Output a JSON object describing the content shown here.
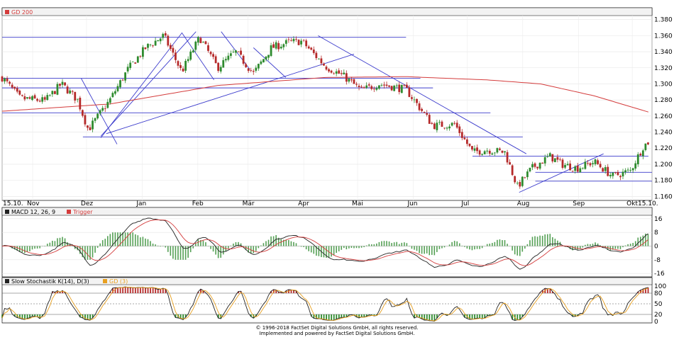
{
  "footer": {
    "line1": "© 1996-2018 FactSet Digital Solutions GmbH, all rights reserved.",
    "line2": "Implemented and powered by FactSet Digital Solutions GmbH."
  },
  "chart_data": [
    {
      "type": "candlestick",
      "legend": [
        "GD 200"
      ],
      "colors": {
        "up": "#2e8b2e",
        "down": "#b52a2a",
        "gd200": "#d43c3c",
        "trendline": "#3c3ccc"
      },
      "x_ticks": [
        "15.10.",
        "Nov",
        "Dez",
        "Jan",
        "Feb",
        "Mär",
        "Apr",
        "Mai",
        "Jun",
        "Jul",
        "Aug",
        "Sep",
        "Okt",
        "15.10."
      ],
      "y_ticks": [
        1.16,
        1.18,
        1.2,
        1.22,
        1.24,
        1.26,
        1.28,
        1.3,
        1.32,
        1.34,
        1.36,
        1.38
      ],
      "ylim": [
        1.155,
        1.385
      ],
      "close_path": [
        {
          "d": 0,
          "v": 1.308
        },
        {
          "d": 10,
          "v": 1.282
        },
        {
          "d": 24,
          "v": 1.279
        },
        {
          "d": 33,
          "v": 1.3
        },
        {
          "d": 42,
          "v": 1.28
        },
        {
          "d": 48,
          "v": 1.243
        },
        {
          "d": 60,
          "v": 1.28
        },
        {
          "d": 70,
          "v": 1.318
        },
        {
          "d": 80,
          "v": 1.345
        },
        {
          "d": 90,
          "v": 1.36
        },
        {
          "d": 100,
          "v": 1.315
        },
        {
          "d": 110,
          "v": 1.358
        },
        {
          "d": 120,
          "v": 1.32
        },
        {
          "d": 130,
          "v": 1.34
        },
        {
          "d": 140,
          "v": 1.313
        },
        {
          "d": 150,
          "v": 1.345
        },
        {
          "d": 160,
          "v": 1.352
        },
        {
          "d": 167,
          "v": 1.353
        },
        {
          "d": 180,
          "v": 1.322
        },
        {
          "d": 190,
          "v": 1.31
        },
        {
          "d": 200,
          "v": 1.292
        },
        {
          "d": 210,
          "v": 1.3
        },
        {
          "d": 225,
          "v": 1.293
        },
        {
          "d": 240,
          "v": 1.248
        },
        {
          "d": 252,
          "v": 1.25
        },
        {
          "d": 262,
          "v": 1.215
        },
        {
          "d": 270,
          "v": 1.218
        },
        {
          "d": 280,
          "v": 1.215
        },
        {
          "d": 287,
          "v": 1.172
        },
        {
          "d": 295,
          "v": 1.195
        },
        {
          "d": 305,
          "v": 1.21
        },
        {
          "d": 312,
          "v": 1.2
        },
        {
          "d": 320,
          "v": 1.195
        },
        {
          "d": 330,
          "v": 1.203
        },
        {
          "d": 340,
          "v": 1.185
        },
        {
          "d": 350,
          "v": 1.192
        },
        {
          "d": 357,
          "v": 1.222
        },
        {
          "d": 360,
          "v": 1.228
        }
      ],
      "gd200": [
        {
          "d": 0,
          "v": 1.266
        },
        {
          "d": 60,
          "v": 1.275
        },
        {
          "d": 120,
          "v": 1.298
        },
        {
          "d": 180,
          "v": 1.308
        },
        {
          "d": 225,
          "v": 1.309
        },
        {
          "d": 270,
          "v": 1.305
        },
        {
          "d": 300,
          "v": 1.3
        },
        {
          "d": 330,
          "v": 1.285
        },
        {
          "d": 360,
          "v": 1.265
        }
      ],
      "horizontal_lines": [
        {
          "v": 1.358,
          "d0": 0,
          "d1": 225
        },
        {
          "v": 1.307,
          "d0": 0,
          "d1": 233
        },
        {
          "v": 1.295,
          "d0": 0,
          "d1": 240
        },
        {
          "v": 1.264,
          "d0": 0,
          "d1": 272
        },
        {
          "v": 1.234,
          "d0": 45,
          "d1": 290
        },
        {
          "v": 1.21,
          "d0": 262,
          "d1": 360
        },
        {
          "v": 1.19,
          "d0": 297,
          "d1": 362
        },
        {
          "v": 1.179,
          "d0": 297,
          "d1": 362
        }
      ],
      "trend_lines": [
        {
          "d0": 44,
          "v0": 1.307,
          "d1": 64,
          "v1": 1.225
        },
        {
          "d0": 55,
          "v0": 1.235,
          "d1": 108,
          "v1": 1.365
        },
        {
          "d0": 55,
          "v0": 1.233,
          "d1": 100,
          "v1": 1.363
        },
        {
          "d0": 58,
          "v0": 1.238,
          "d1": 196,
          "v1": 1.337
        },
        {
          "d0": 100,
          "v0": 1.364,
          "d1": 118,
          "v1": 1.305
        },
        {
          "d0": 122,
          "v0": 1.365,
          "d1": 138,
          "v1": 1.318
        },
        {
          "d0": 140,
          "v0": 1.345,
          "d1": 158,
          "v1": 1.308
        },
        {
          "d0": 176,
          "v0": 1.36,
          "d1": 292,
          "v1": 1.213
        },
        {
          "d0": 288,
          "v0": 1.165,
          "d1": 335,
          "v1": 1.213
        }
      ]
    },
    {
      "type": "line",
      "legend": [
        "MACD 12, 26, 9",
        "Trigger"
      ],
      "colors": {
        "macd": "#222222",
        "trigger": "#d43c3c",
        "histogram": "#55a055"
      },
      "y_ticks": [
        16,
        8,
        0,
        -8,
        -16
      ],
      "ylim": [
        -18,
        18
      ]
    },
    {
      "type": "line",
      "legend": [
        "Slow Stochastik K(14), D(3)",
        "GD (3)"
      ],
      "colors": {
        "k": "#222222",
        "d": "#e8a020",
        "overbought": "#b52a2a",
        "oversold": "#2e8b2e"
      },
      "y_ticks": [
        100,
        80,
        50,
        20,
        0
      ],
      "ylim": [
        0,
        100
      ]
    }
  ]
}
